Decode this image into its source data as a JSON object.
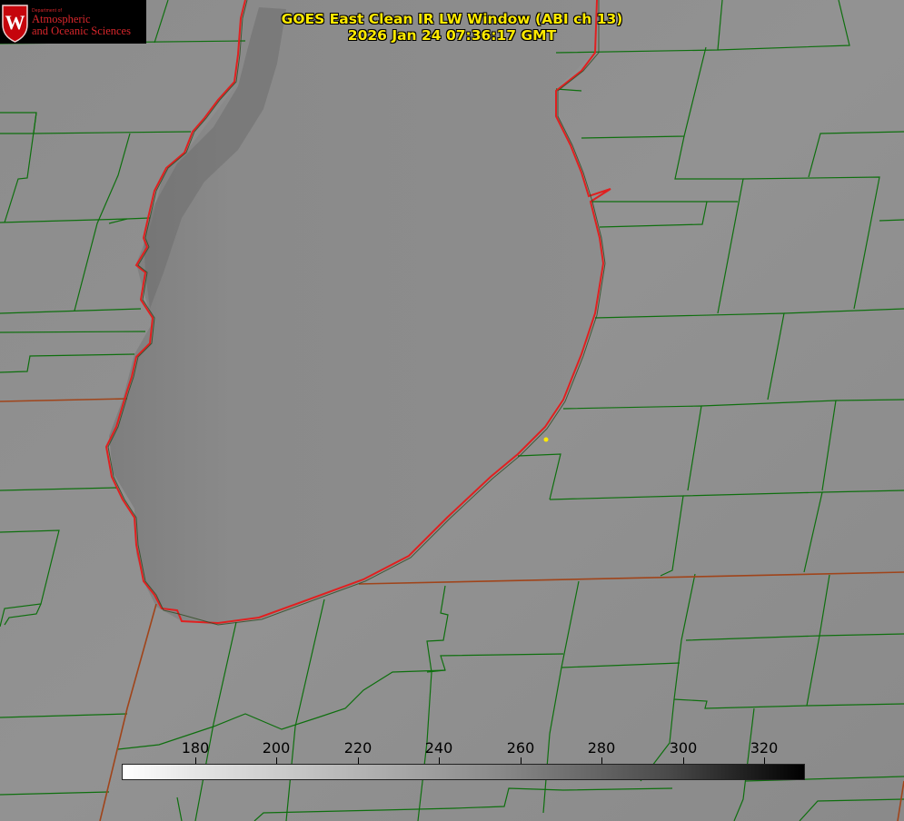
{
  "title": {
    "line1": "GOES East Clean IR LW Window (ABI ch 13)",
    "line2": "2026 Jan 24 07:36:17 GMT"
  },
  "logo": {
    "department": "Department of",
    "line1": "Atmospheric",
    "line2": "and Oceanic Sciences",
    "crest_letter": "W"
  },
  "colorbar": {
    "ticks": [
      "180",
      "200",
      "220",
      "240",
      "260",
      "280",
      "300",
      "320"
    ],
    "gradient": [
      "#ffffff",
      "#000000"
    ]
  },
  "colors": {
    "background": "#8f8f8f",
    "county_lines": "#0e6f0e",
    "state_lines": "#a0441a",
    "coastline": "#e02020",
    "title_text": "#ffea00",
    "logo_red": "#d7262b"
  }
}
